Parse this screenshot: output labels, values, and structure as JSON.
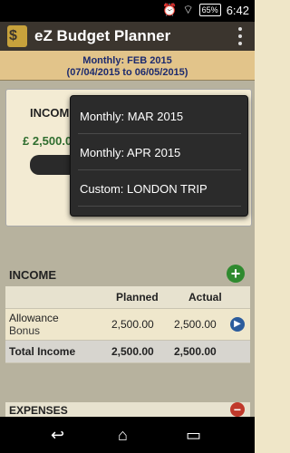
{
  "status": {
    "time": "6:42",
    "battery": "65%"
  },
  "app": {
    "title": "eZ Budget Planner",
    "icon": "ledger-icon"
  },
  "period": {
    "title": "Monthly: FEB 2015",
    "range": "(07/04/2015 to 06/05/2015)"
  },
  "summary": {
    "label": "INCOME",
    "amount": "£ 2,500.00"
  },
  "income": {
    "title": "INCOME",
    "headers": {
      "planned": "Planned",
      "actual": "Actual"
    },
    "rows": [
      {
        "name": "Allowance",
        "sub": "Bonus",
        "planned": "2,500.00",
        "actual": "2,500.00"
      }
    ],
    "total": {
      "label": "Total Income",
      "planned": "2,500.00",
      "actual": "2,500.00"
    }
  },
  "expenses": {
    "title": "EXPENSES"
  },
  "popup": {
    "items": [
      "Monthly: MAR 2015",
      "Monthly: APR 2015",
      "Custom: LONDON TRIP"
    ]
  }
}
